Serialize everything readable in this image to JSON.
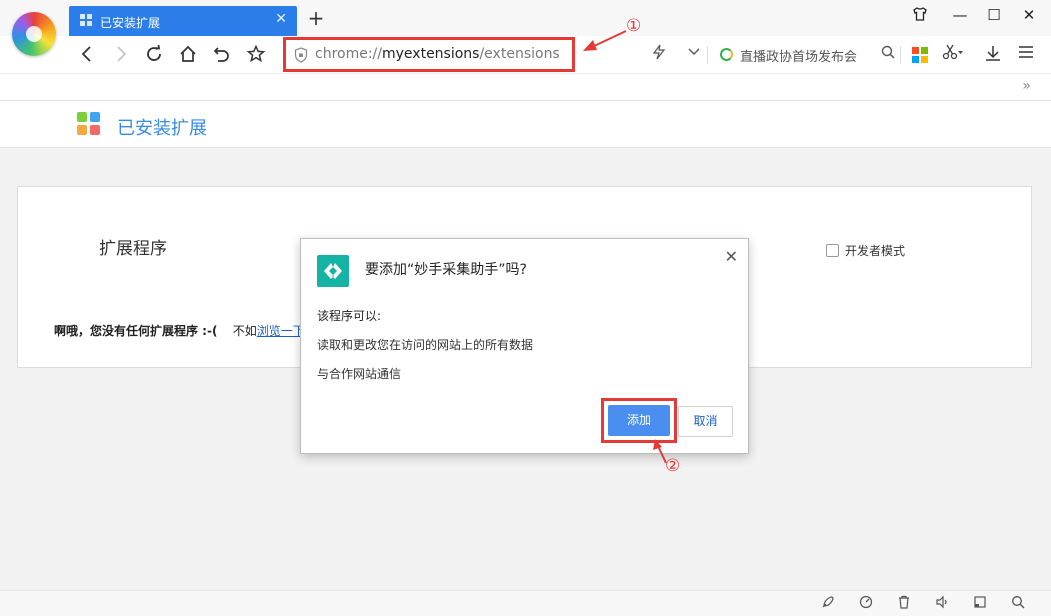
{
  "tab": {
    "title": "已安装扩展",
    "close": "✕"
  },
  "address_bar": {
    "url_prefix": "chrome://",
    "url_host": "myextensions",
    "url_path": "/extensions"
  },
  "search": {
    "text": "直播政协首场发布会"
  },
  "page": {
    "header_title": "已安装扩展",
    "section_title": "扩展程序",
    "developer_mode_label": "开发者模式"
  },
  "empty_message": {
    "bold": "啊哦，您没有任何扩展程序 :-(",
    "text": "不如",
    "link": "浏览一下"
  },
  "dialog": {
    "title": "要添加“妙手采集助手”吗?",
    "permissions_heading": "该程序可以:",
    "permissions": [
      "读取和更改您在访问的网站上的所有数据",
      "与合作网站通信"
    ],
    "add_button": "添加",
    "cancel_button": "取消",
    "close": "✕"
  },
  "annotations": {
    "step1": "①",
    "step2": "②"
  },
  "colors": {
    "tab_blue": "#2b7de9",
    "highlight_red": "#e53935",
    "link_blue": "#3a8be6",
    "extension_teal": "#14b3a6",
    "add_button_blue": "#4a8ef0"
  }
}
